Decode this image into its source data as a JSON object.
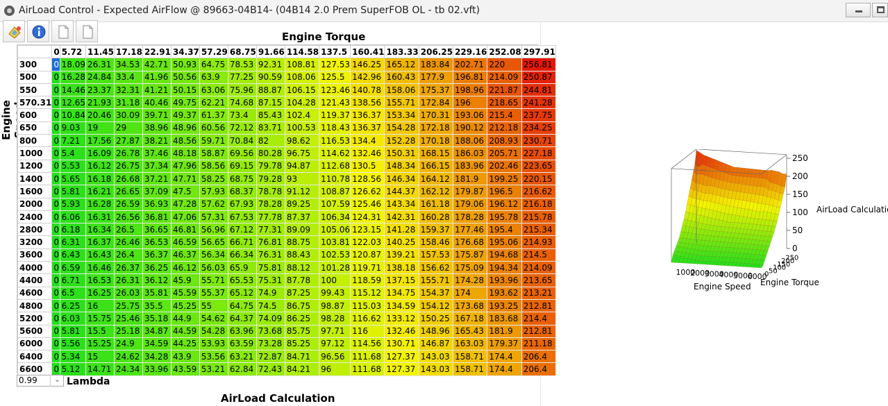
{
  "window": {
    "title": "AirLoad Control - Expected AirFlow @ 89663-04B14- (04B14 2.0 Prem SuperFOB OL - tb 02.vft)"
  },
  "toolbar": {
    "icons": [
      "paint-icon",
      "info-icon",
      "page-icon",
      "page-icon"
    ]
  },
  "table": {
    "title": "Engine Torque",
    "row_axis_label": "Engine Speed",
    "columns": [
      "0",
      "5.72",
      "11.45",
      "17.18",
      "22.91",
      "34.37",
      "57.29",
      "68.75",
      "91.66",
      "114.58",
      "137.5",
      "160.41",
      "183.33",
      "206.25",
      "229.16",
      "252.08",
      "297.91"
    ],
    "rows": [
      {
        "label": "300",
        "values": [
          "0",
          "18.09",
          "26.31",
          "34.53",
          "42.71",
          "50.93",
          "64.75",
          "78.53",
          "92.31",
          "108.81",
          "127.53",
          "146.25",
          "165.12",
          "183.84",
          "202.71",
          "220",
          "256.81"
        ]
      },
      {
        "label": "500",
        "values": [
          "0",
          "16.28",
          "24.84",
          "33.4",
          "41.96",
          "50.56",
          "63.9",
          "77.25",
          "90.59",
          "108.06",
          "125.5",
          "142.96",
          "160.43",
          "177.9",
          "196.81",
          "214.09",
          "250.87"
        ]
      },
      {
        "label": "550",
        "values": [
          "0",
          "14.46",
          "23.37",
          "32.31",
          "41.21",
          "50.15",
          "63.06",
          "75.96",
          "88.87",
          "106.15",
          "123.46",
          "140.78",
          "158.06",
          "175.37",
          "198.96",
          "221.87",
          "244.81"
        ]
      },
      {
        "label": "570.31",
        "values": [
          "0",
          "12.65",
          "21.93",
          "31.18",
          "40.46",
          "49.75",
          "62.21",
          "74.68",
          "87.15",
          "104.28",
          "121.43",
          "138.56",
          "155.71",
          "172.84",
          "196",
          "218.65",
          "241.28"
        ]
      },
      {
        "label": "600",
        "values": [
          "0",
          "10.84",
          "20.46",
          "30.09",
          "39.71",
          "49.37",
          "61.37",
          "73.4",
          "85.43",
          "102.4",
          "119.37",
          "136.37",
          "153.34",
          "170.31",
          "193.06",
          "215.4",
          "237.75"
        ]
      },
      {
        "label": "650",
        "values": [
          "0",
          "9.03",
          "19",
          "29",
          "38.96",
          "48.96",
          "60.56",
          "72.12",
          "83.71",
          "100.53",
          "118.43",
          "136.37",
          "154.28",
          "172.18",
          "190.12",
          "212.18",
          "234.25"
        ]
      },
      {
        "label": "800",
        "values": [
          "0",
          "7.21",
          "17.56",
          "27.87",
          "38.21",
          "48.56",
          "59.71",
          "70.84",
          "82",
          "98.62",
          "116.53",
          "134.4",
          "152.28",
          "170.18",
          "188.06",
          "208.93",
          "230.71"
        ]
      },
      {
        "label": "1000",
        "values": [
          "0",
          "5.4",
          "16.09",
          "26.78",
          "37.46",
          "48.18",
          "58.87",
          "69.56",
          "80.28",
          "96.75",
          "114.62",
          "132.46",
          "150.31",
          "168.15",
          "186.03",
          "205.71",
          "227.18"
        ]
      },
      {
        "label": "1200",
        "values": [
          "0",
          "5.53",
          "16.12",
          "26.75",
          "37.34",
          "47.96",
          "58.56",
          "69.15",
          "79.78",
          "94.87",
          "112.68",
          "130.5",
          "148.34",
          "166.15",
          "183.96",
          "202.46",
          "223.65"
        ]
      },
      {
        "label": "1400",
        "values": [
          "0",
          "5.65",
          "16.18",
          "26.68",
          "37.21",
          "47.71",
          "58.25",
          "68.75",
          "79.28",
          "93",
          "110.78",
          "128.56",
          "146.34",
          "164.12",
          "181.9",
          "199.25",
          "220.15"
        ]
      },
      {
        "label": "1600",
        "values": [
          "0",
          "5.81",
          "16.21",
          "26.65",
          "37.09",
          "47.5",
          "57.93",
          "68.37",
          "78.78",
          "91.12",
          "108.87",
          "126.62",
          "144.37",
          "162.12",
          "179.87",
          "196.5",
          "216.62"
        ]
      },
      {
        "label": "2000",
        "values": [
          "0",
          "5.93",
          "16.28",
          "26.59",
          "36.93",
          "47.28",
          "57.62",
          "67.93",
          "78.28",
          "89.25",
          "107.59",
          "125.46",
          "143.34",
          "161.18",
          "179.06",
          "196.12",
          "216.18"
        ]
      },
      {
        "label": "2400",
        "values": [
          "0",
          "6.06",
          "16.31",
          "26.56",
          "36.81",
          "47.06",
          "57.31",
          "67.53",
          "77.78",
          "87.37",
          "106.34",
          "124.31",
          "142.31",
          "160.28",
          "178.28",
          "195.78",
          "215.78"
        ]
      },
      {
        "label": "2800",
        "values": [
          "0",
          "6.18",
          "16.34",
          "26.5",
          "36.65",
          "46.81",
          "56.96",
          "67.12",
          "77.31",
          "89.09",
          "105.06",
          "123.15",
          "141.28",
          "159.37",
          "177.46",
          "195.4",
          "215.34"
        ]
      },
      {
        "label": "3200",
        "values": [
          "0",
          "6.31",
          "16.37",
          "26.46",
          "36.53",
          "46.59",
          "56.65",
          "66.71",
          "76.81",
          "88.75",
          "103.81",
          "122.03",
          "140.25",
          "158.46",
          "176.68",
          "195.06",
          "214.93"
        ]
      },
      {
        "label": "3600",
        "values": [
          "0",
          "6.43",
          "16.43",
          "26.4",
          "36.37",
          "46.37",
          "56.34",
          "66.34",
          "76.31",
          "88.43",
          "102.53",
          "120.87",
          "139.21",
          "157.53",
          "175.87",
          "194.68",
          "214.5"
        ]
      },
      {
        "label": "4000",
        "values": [
          "0",
          "6.59",
          "16.46",
          "26.37",
          "36.25",
          "46.12",
          "56.03",
          "65.9",
          "75.81",
          "88.12",
          "101.28",
          "119.71",
          "138.18",
          "156.62",
          "175.09",
          "194.34",
          "214.09"
        ]
      },
      {
        "label": "4400",
        "values": [
          "0",
          "6.71",
          "16.53",
          "26.31",
          "36.12",
          "45.9",
          "55.71",
          "65.53",
          "75.31",
          "87.78",
          "100",
          "118.59",
          "137.15",
          "155.71",
          "174.28",
          "193.96",
          "213.65"
        ]
      },
      {
        "label": "4600",
        "values": [
          "0",
          "6.5",
          "16.25",
          "26.03",
          "35.81",
          "45.59",
          "55.37",
          "65.12",
          "74.9",
          "87.25",
          "99.43",
          "115.12",
          "134.75",
          "154.37",
          "174",
          "193.62",
          "213.21"
        ]
      },
      {
        "label": "4800",
        "values": [
          "0",
          "6.25",
          "16",
          "25.75",
          "35.5",
          "45.25",
          "55",
          "64.75",
          "74.5",
          "86.75",
          "98.87",
          "115.03",
          "134.59",
          "154.12",
          "173.68",
          "193.25",
          "212.81"
        ]
      },
      {
        "label": "5200",
        "values": [
          "0",
          "6.03",
          "15.75",
          "25.46",
          "35.18",
          "44.9",
          "54.62",
          "64.37",
          "74.09",
          "86.25",
          "98.28",
          "116.62",
          "133.12",
          "150.25",
          "167.18",
          "183.68",
          "214.4"
        ]
      },
      {
        "label": "5600",
        "values": [
          "0",
          "5.81",
          "15.5",
          "25.18",
          "34.87",
          "44.59",
          "54.28",
          "63.96",
          "73.68",
          "85.75",
          "97.71",
          "116",
          "132.46",
          "148.96",
          "165.43",
          "181.9",
          "212.81"
        ]
      },
      {
        "label": "6000",
        "values": [
          "0",
          "5.56",
          "15.25",
          "24.9",
          "34.59",
          "44.25",
          "53.93",
          "63.59",
          "73.28",
          "85.25",
          "97.12",
          "114.56",
          "130.71",
          "146.87",
          "163.03",
          "179.37",
          "211.18"
        ]
      },
      {
        "label": "6400",
        "values": [
          "0",
          "5.34",
          "15",
          "24.62",
          "34.28",
          "43.9",
          "53.56",
          "63.21",
          "72.87",
          "84.71",
          "96.56",
          "111.68",
          "127.37",
          "143.03",
          "158.71",
          "174.4",
          "206.4"
        ]
      },
      {
        "label": "6600",
        "values": [
          "0",
          "5.12",
          "14.71",
          "24.34",
          "33.96",
          "43.59",
          "53.21",
          "62.84",
          "72.43",
          "84.21",
          "96",
          "111.68",
          "127.37",
          "143.03",
          "158.71",
          "174.4",
          "206.4"
        ]
      }
    ]
  },
  "lambda": {
    "value": "0.99",
    "label": "Lambda"
  },
  "bottom_title": "AirLoad Calculation",
  "plot": {
    "z_label": "AirLoad Calculation",
    "x_label": "Engine Speed",
    "y_label": "Engine Torque",
    "z_ticks": [
      "250",
      "200",
      "150",
      "100",
      "50",
      "0"
    ],
    "x_ticks": [
      "1000",
      "2000",
      "3000",
      "4000",
      "5000",
      "6000"
    ],
    "y_ticks": [
      "0",
      "50",
      "100",
      "150",
      "200",
      "250"
    ]
  },
  "colors": {
    "low": "#22e01a",
    "mid": "#f4f400",
    "high": "#e01a0a",
    "selected": "#1b6fd4"
  }
}
